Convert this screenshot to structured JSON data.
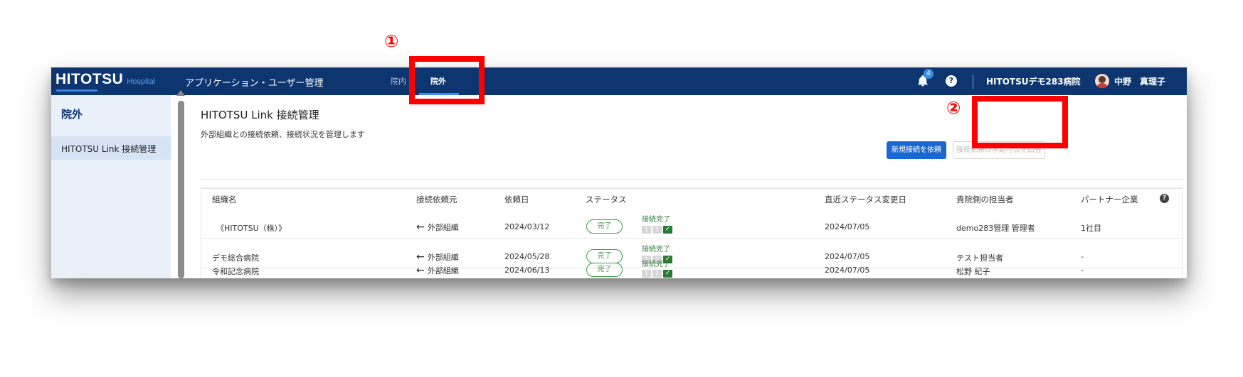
{
  "app": {
    "logo": "HITOTSU",
    "logo_sub": "Hospital",
    "nav_app": "アプリケーション・ユーザー管理",
    "tabs": [
      {
        "label": "院内"
      },
      {
        "label": "院外"
      }
    ],
    "notification_count": "4",
    "help_icon": "?",
    "hospital_name": "HITOTSUデモ283病院",
    "user_name": "中野　真理子"
  },
  "sidebar": {
    "title": "院外",
    "items": [
      {
        "label": "HITOTSU Link 接続管理"
      }
    ]
  },
  "page": {
    "title": "HITOTSU Link 接続管理",
    "description": "外部組織との接続依頼、接続状況を管理します",
    "primary_button": "新規接続を依頼",
    "secondary_button": "接続依頼の承認可否を回答"
  },
  "table": {
    "headers": [
      "組織名",
      "接続依頼元",
      "依頼日",
      "ステータス",
      "直近ステータス変更日",
      "貴院側の担当者",
      "パートナー企業"
    ],
    "rows": [
      {
        "org": "《HITOTSU（株）》",
        "from": "外部組織",
        "date": "2024/03/12",
        "status": "完了",
        "conn": "接続完了",
        "steps": [
          "1",
          "2"
        ],
        "changed": "2024/07/05",
        "contact": "demo283管理 管理者",
        "partner": "1社目"
      },
      {
        "org": "デモ総合病院",
        "from": "外部組織",
        "date": "2024/05/28",
        "status": "完了",
        "conn": "接続完了",
        "steps": [
          "1",
          "2"
        ],
        "changed": "2024/07/05",
        "contact": "テスト担当者",
        "partner": "-"
      },
      {
        "org": "令和記念病院",
        "from": "外部組織",
        "date": "2024/06/13",
        "status": "完了",
        "conn": "接続完了",
        "steps": [
          "1",
          "2"
        ],
        "changed": "2024/07/05",
        "contact": "松野 紀子",
        "partner": "-"
      }
    ]
  },
  "annotations": {
    "marker1": "①",
    "marker2": "②"
  },
  "colors": {
    "header_bg": "#0d3670",
    "primary": "#1967d2",
    "marker": "#ff0000",
    "status_green": "#3e9a4b"
  }
}
